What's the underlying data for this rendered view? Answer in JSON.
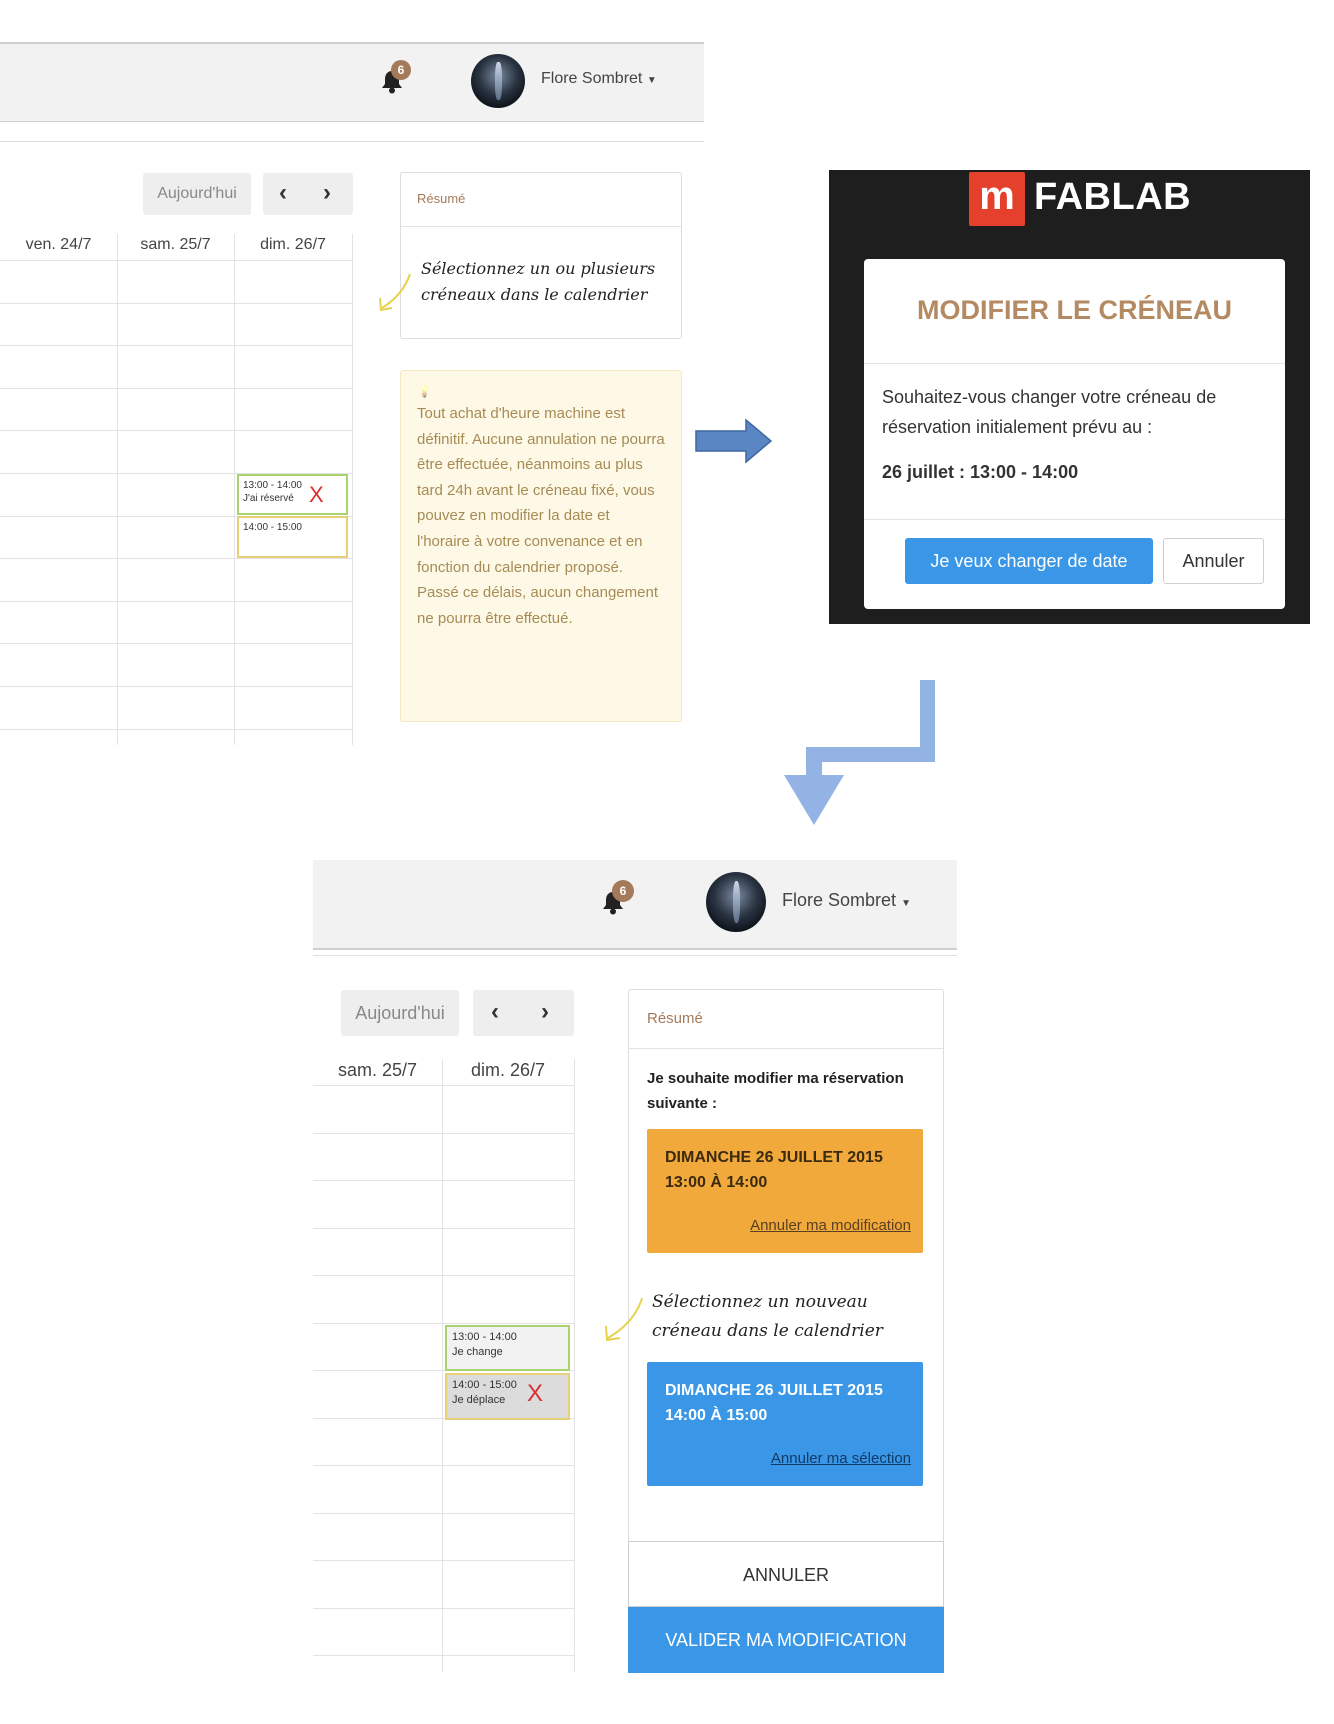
{
  "panel1": {
    "notifications_count": "6",
    "user_name": "Flore Sombret",
    "today_label": "Aujourd'hui",
    "prev_label": "‹",
    "next_label": "›",
    "columns": [
      "ven. 24/7",
      "sam. 25/7",
      "dim. 26/7"
    ],
    "events": [
      {
        "time": "13:00 - 14:00",
        "label": "J'ai réservé",
        "close": "X"
      },
      {
        "time": "14:00 - 15:00",
        "label": ""
      }
    ],
    "summary_title": "Résumé",
    "summary_hint_line1": "Sélectionnez un ou plusieurs",
    "summary_hint_line2": "créneaux dans le calendrier",
    "note_icon": "💡",
    "note_text": "Tout achat d'heure machine est définitif. Aucune annulation ne pourra être effectuée, néanmoins au plus tard 24h avant le créneau fixé, vous pouvez en modifier la date et l'horaire à votre convenance et en fonction du calendrier proposé. Passé ce délais, aucun changement ne pourra être effectué."
  },
  "modal": {
    "logo_letter": "m",
    "logo_text": "FABLAB",
    "title": "MODIFIER LE CRÉNEAU",
    "body": "Souhaitez-vous changer votre créneau de réservation initialement prévu au :",
    "slot": "26 juillet : 13:00 - 14:00",
    "confirm_label": "Je veux changer de date",
    "cancel_label": "Annuler"
  },
  "panel2": {
    "notifications_count": "6",
    "user_name": "Flore Sombret",
    "today_label": "Aujourd'hui",
    "prev_label": "‹",
    "next_label": "›",
    "columns": [
      "sam. 25/7",
      "dim. 26/7"
    ],
    "events": [
      {
        "time": "13:00 - 14:00",
        "label": "Je change"
      },
      {
        "time": "14:00 - 15:00",
        "label": "Je déplace",
        "close": "X"
      }
    ],
    "summary_title": "Résumé",
    "intro": "Je souhaite modifier ma réservation suivante :",
    "current": {
      "date": "DIMANCHE 26 JUILLET 2015",
      "time": "13:00 À 14:00",
      "link": "Annuler ma modification"
    },
    "hint_line1": "Sélectionnez un nouveau",
    "hint_line2": "créneau dans le calendrier",
    "new": {
      "date": "DIMANCHE 26 JUILLET 2015",
      "time": "14:00 À 15:00",
      "link": "Annuler ma sélection"
    },
    "cancel_label": "ANNULER",
    "validate_label": "VALIDER MA MODIFICATION"
  },
  "colors": {
    "accent_brown": "#a57a5a",
    "primary_blue": "#3a97e8",
    "orange": "#f2a93b",
    "logo_red": "#e4402c",
    "flow_arrow": "#5b86c4"
  }
}
